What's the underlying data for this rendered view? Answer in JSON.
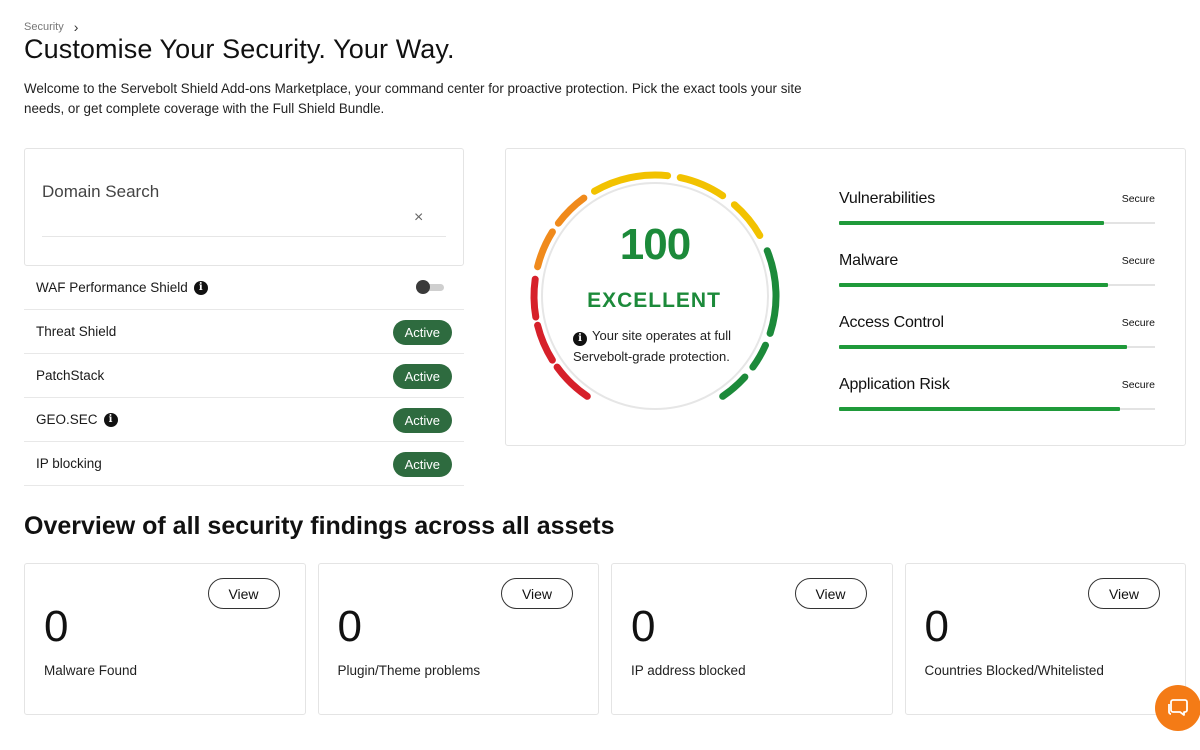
{
  "breadcrumb": {
    "label": "Security",
    "chevron": "›"
  },
  "header": {
    "title": "Customise Your Security. Your Way.",
    "intro": "Welcome to the Servebolt Shield Add-ons Marketplace, your command center for proactive protection. Pick the exact tools your site needs, or get complete coverage with the Full Shield Bundle."
  },
  "domain_search": {
    "label": "Domain Search",
    "clear_icon": "×"
  },
  "shields": [
    {
      "name": "WAF Performance Shield",
      "info": true,
      "control": "toggle",
      "enabled": false
    },
    {
      "name": "Threat Shield",
      "control": "badge",
      "status": "Active"
    },
    {
      "name": "PatchStack",
      "control": "badge",
      "status": "Active"
    },
    {
      "name": "GEO.SEC",
      "info": true,
      "control": "badge",
      "status": "Active"
    },
    {
      "name": "IP blocking",
      "control": "badge",
      "status": "Active"
    }
  ],
  "score": {
    "value": "100",
    "rating": "EXCELLENT",
    "note": "Your site operates at full Servebolt-grade protection.",
    "info_icon": "i",
    "colors": {
      "good": "#1c8a3a",
      "warn": "#f2c200",
      "mid": "#f08a1c",
      "bad": "#d6202a"
    }
  },
  "metrics": [
    {
      "name": "Vulnerabilities",
      "status": "Secure",
      "level": 0.84
    },
    {
      "name": "Malware",
      "status": "Secure",
      "level": 0.85
    },
    {
      "name": "Access Control",
      "status": "Secure",
      "level": 0.91
    },
    {
      "name": "Application Risk",
      "status": "Secure",
      "level": 0.89
    }
  ],
  "overview": {
    "title": "Overview of all security findings across all assets",
    "cards": [
      {
        "value": "0",
        "label": "Malware Found",
        "button": "View"
      },
      {
        "value": "0",
        "label": "Plugin/Theme problems",
        "button": "View"
      },
      {
        "value": "0",
        "label": "IP address blocked",
        "button": "View"
      },
      {
        "value": "0",
        "label": "Countries Blocked/Whitelisted",
        "button": "View"
      }
    ]
  },
  "chat": {
    "icon": "chat-bubble-icon",
    "color": "#f47b16"
  }
}
